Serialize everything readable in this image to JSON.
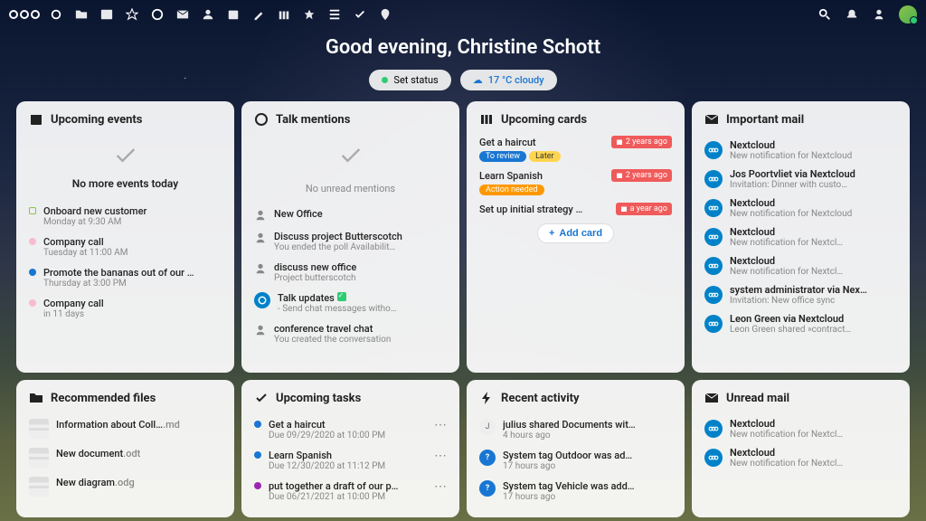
{
  "greeting": "Good evening, Christine Schott",
  "status_pill": "Set status",
  "weather_pill": "17 °C cloudy",
  "widgets": {
    "events": {
      "title": "Upcoming events",
      "empty": "No more events today",
      "items": [
        {
          "title": "Onboard new customer",
          "sub": "Monday at 9:30 AM",
          "color": "#8bc34a",
          "shape": "square-outline"
        },
        {
          "title": "Company call",
          "sub": "Tuesday at 11:00 AM",
          "color": "#f8bbd0",
          "shape": "circle"
        },
        {
          "title": "Promote the bananas out of our …",
          "sub": "Thursday at 3:00 PM",
          "color": "#1976d2",
          "shape": "circle"
        },
        {
          "title": "Company call",
          "sub": "in 11 days",
          "color": "#f8bbd0",
          "shape": "circle"
        }
      ]
    },
    "talk": {
      "title": "Talk mentions",
      "empty": "No unread mentions",
      "items": [
        {
          "title": "New Office",
          "sub": ""
        },
        {
          "title": "Discuss project Butterscotch",
          "sub": "You ended the poll Availabilit…"
        },
        {
          "title": "discuss new office",
          "sub": "Project butterscotch"
        },
        {
          "title": "Talk updates",
          "sub": "- Send chat messages witho…",
          "special": "check"
        },
        {
          "title": "conference travel chat",
          "sub": "You created the conversation"
        }
      ]
    },
    "cards": {
      "title": "Upcoming cards",
      "add_label": "Add card",
      "items": [
        {
          "title": "Get a haircut",
          "due": "2 years ago",
          "tags": [
            [
              "To review",
              "blue"
            ],
            [
              "Later",
              "yellow"
            ]
          ]
        },
        {
          "title": "Learn Spanish",
          "due": "2 years ago",
          "tags": [
            [
              "Action needed",
              "orange"
            ]
          ]
        },
        {
          "title": "Set up initial strategy …",
          "due": "a year ago",
          "tags": []
        }
      ]
    },
    "mail_imp": {
      "title": "Important mail",
      "items": [
        {
          "from": "Nextcloud",
          "sub": "New notification for Nextcloud"
        },
        {
          "from": "Jos Poortvliet via Nextcloud",
          "sub": "Invitation: Dinner with custo…"
        },
        {
          "from": "Nextcloud",
          "sub": "New notification for Nextcloud"
        },
        {
          "from": "Nextcloud",
          "sub": "New notification for Nextcl…"
        },
        {
          "from": "Nextcloud",
          "sub": "New notification for Nextcl…"
        },
        {
          "from": "system administrator via Nex…",
          "sub": "Invitation: New office sync"
        },
        {
          "from": "Leon Green via Nextcloud",
          "sub": "Leon Green shared »contract…"
        }
      ]
    },
    "files": {
      "title": "Recommended files",
      "items": [
        {
          "title": "Information about Coll…",
          "ext": ".md"
        },
        {
          "title": "New document",
          "ext": ".odt"
        },
        {
          "title": "New diagram",
          "ext": ".odg"
        }
      ]
    },
    "tasks": {
      "title": "Upcoming tasks",
      "items": [
        {
          "title": "Get a haircut",
          "sub": "Due 09/29/2020 at 10:00 PM",
          "color": "#1976d2"
        },
        {
          "title": "Learn Spanish",
          "sub": "Due 12/30/2020 at 11:12 PM",
          "color": "#1976d2"
        },
        {
          "title": "put together a draft of our p…",
          "sub": "Due 06/21/2021 at 10:00 PM",
          "color": "#9c27b0"
        }
      ]
    },
    "activity": {
      "title": "Recent activity",
      "items": [
        {
          "title": "julius shared Documents wit…",
          "sub": "4 hours ago",
          "avatar": "J"
        },
        {
          "title": "System tag Outdoor was ad…",
          "sub": "17 hours ago",
          "avatar": "?"
        },
        {
          "title": "System tag Vehicle was add…",
          "sub": "17 hours ago",
          "avatar": "?"
        }
      ]
    },
    "mail_unread": {
      "title": "Unread mail",
      "items": [
        {
          "from": "Nextcloud",
          "sub": "New notification for Nextcl…"
        },
        {
          "from": "Nextcloud",
          "sub": "New notification for Nextcl…"
        }
      ]
    }
  }
}
